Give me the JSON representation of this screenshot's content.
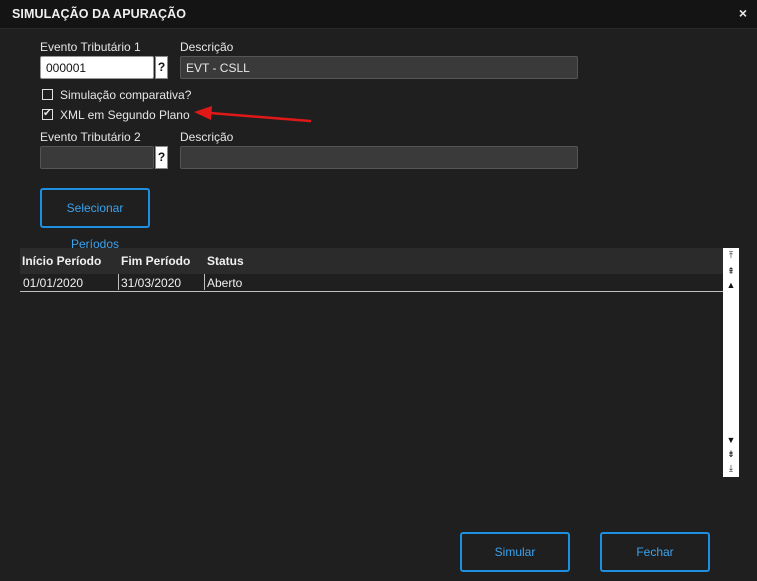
{
  "window": {
    "title": "SIMULAÇÃO DA APURAÇÃO",
    "close_glyph": "×"
  },
  "form": {
    "evento1": {
      "label": "Evento Tributário 1",
      "value": "000001",
      "help": "?"
    },
    "descricao1": {
      "label": "Descrição",
      "value": "EVT - CSLL"
    },
    "simulacao_comparativa": {
      "label": "Simulação comparativa?",
      "checked": false
    },
    "xml_segundo_plano": {
      "label": "XML em Segundo Plano",
      "checked": true,
      "tick": "✔"
    },
    "evento2": {
      "label": "Evento Tributário 2",
      "value": "",
      "help": "?"
    },
    "descricao2": {
      "label": "Descrição",
      "value": ""
    },
    "selecionar_periodos": "Selecionar Períodos"
  },
  "grid": {
    "columns": [
      "Início Período",
      "Fim Período",
      "Status"
    ],
    "rows": [
      {
        "inicio": "01/01/2020",
        "fim": "31/03/2020",
        "status": "Aberto"
      }
    ],
    "scroll_icons": {
      "top": "⤒",
      "page_up": "⇞",
      "up": "▲",
      "down": "▼",
      "page_down": "⇟",
      "bottom": "⤓"
    }
  },
  "footer": {
    "simular": "Simular",
    "fechar": "Fechar"
  },
  "colors": {
    "accent": "#1e8fe0",
    "annotation_arrow": "#e01818"
  },
  "annotation": {
    "icon": "red-arrow-icon"
  }
}
